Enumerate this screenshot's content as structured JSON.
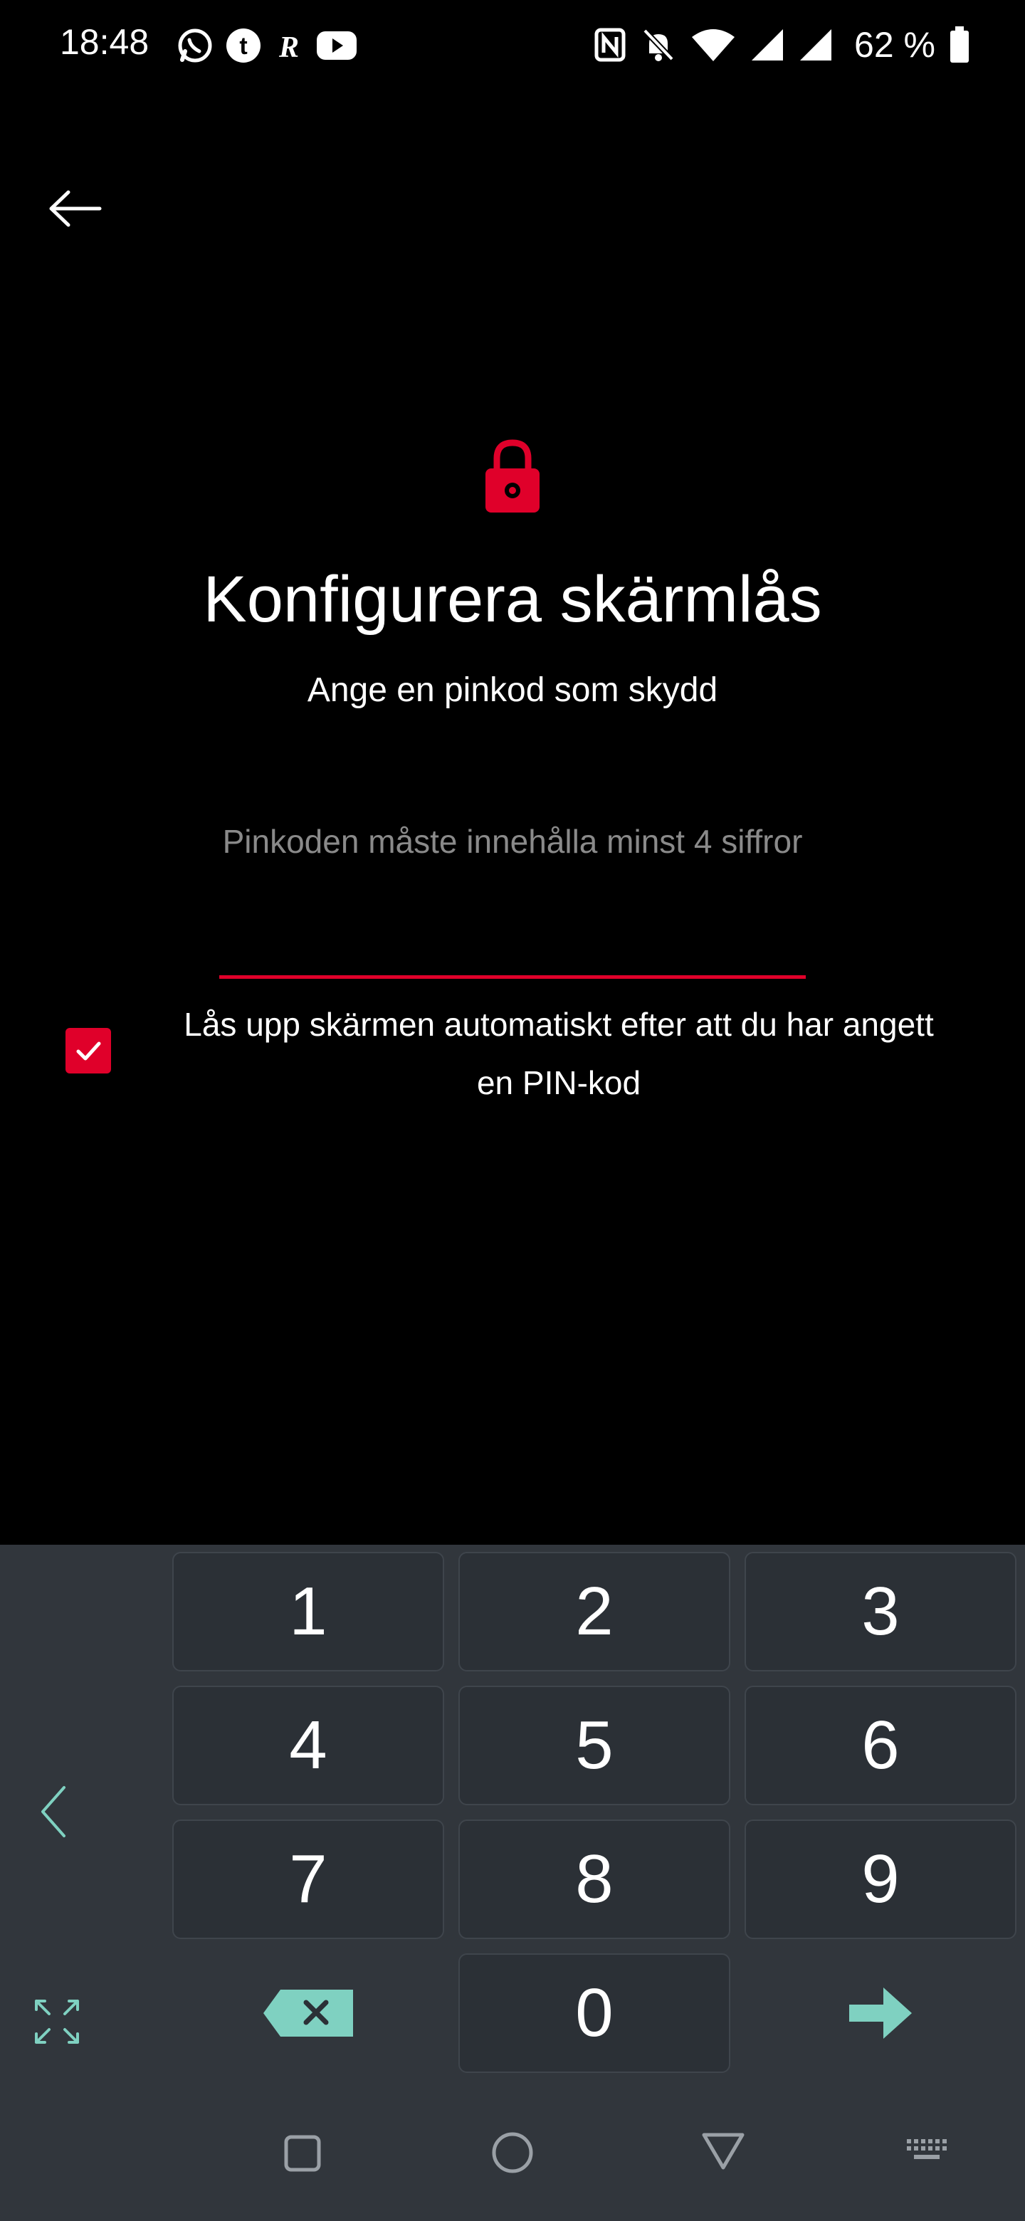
{
  "status_bar": {
    "time": "18:48",
    "battery_text": "62 %",
    "app_icons": [
      "whatsapp-icon",
      "tumblr-icon",
      "r-app-icon",
      "youtube-icon"
    ],
    "system_icons": [
      "nfc-icon",
      "bell-muted-icon",
      "wifi-icon",
      "signal-icon",
      "signal-icon",
      "battery-icon"
    ]
  },
  "header": {
    "title": "Konfigurera skärmlås",
    "subtitle": "Ange en pinkod som skydd"
  },
  "pin": {
    "hint": "Pinkoden måste innehålla minst 4 siffror",
    "value": ""
  },
  "auto_unlock": {
    "checked": true,
    "label": "Lås upp skärmen automatiskt efter att du har angett en PIN-kod"
  },
  "keypad": {
    "keys": [
      "1",
      "2",
      "3",
      "4",
      "5",
      "6",
      "7",
      "8",
      "9",
      "0"
    ]
  },
  "colors": {
    "accent": "#e0002a",
    "keypad_bg": "#31363c",
    "key_bg": "#2b3036",
    "key_teal": "#7fd1c1"
  }
}
